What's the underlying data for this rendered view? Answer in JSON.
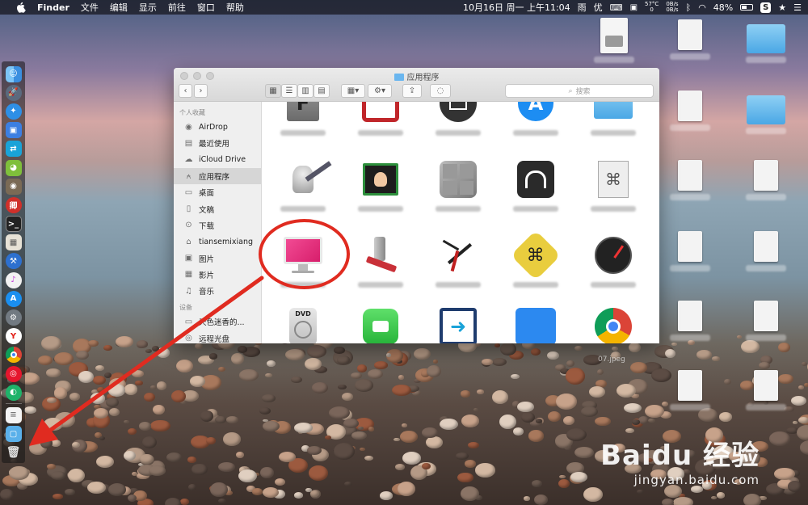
{
  "menubar": {
    "app_name": "Finder",
    "menus": [
      "文件",
      "编辑",
      "显示",
      "前往",
      "窗口",
      "帮助"
    ],
    "datetime": "10月16日 周一 上午11:04",
    "weather": "雨",
    "you": "优",
    "cpu_temp": "57°C",
    "cpu_val": "0",
    "net_up": "0B/s",
    "net_down": "0B/s",
    "battery": "48%"
  },
  "finder": {
    "title": "应用程序",
    "search_placeholder": "搜索",
    "sidebar_favorites_header": "个人收藏",
    "sidebar_devices_header": "设备",
    "sidebar_items": [
      {
        "label": "AirDrop",
        "icon": "airdrop-icon"
      },
      {
        "label": "最近使用",
        "icon": "recents-icon"
      },
      {
        "label": "iCloud Drive",
        "icon": "cloud-icon"
      },
      {
        "label": "应用程序",
        "icon": "applications-icon"
      },
      {
        "label": "桌面",
        "icon": "desktop-icon"
      },
      {
        "label": "文稿",
        "icon": "documents-icon"
      },
      {
        "label": "下载",
        "icon": "downloads-icon"
      },
      {
        "label": "tiansemixiang",
        "icon": "home-icon"
      },
      {
        "label": "图片",
        "icon": "pictures-icon"
      },
      {
        "label": "影片",
        "icon": "movies-icon"
      },
      {
        "label": "音乐",
        "icon": "music-icon"
      }
    ],
    "device_items": [
      {
        "label": "天色迷香的...",
        "icon": "computer-icon"
      },
      {
        "label": "远程光盘",
        "icon": "disc-icon"
      }
    ]
  },
  "desktop": {
    "wallpaper_caption": "07.jpeg"
  },
  "watermark": {
    "brand": "Baidu 经验",
    "url": "jingyan.baidu.com"
  },
  "colors": {
    "annotation_red": "#e02b20",
    "cleanmymac_pink": "#e8307a",
    "folder_blue": "#4aa7e5"
  }
}
